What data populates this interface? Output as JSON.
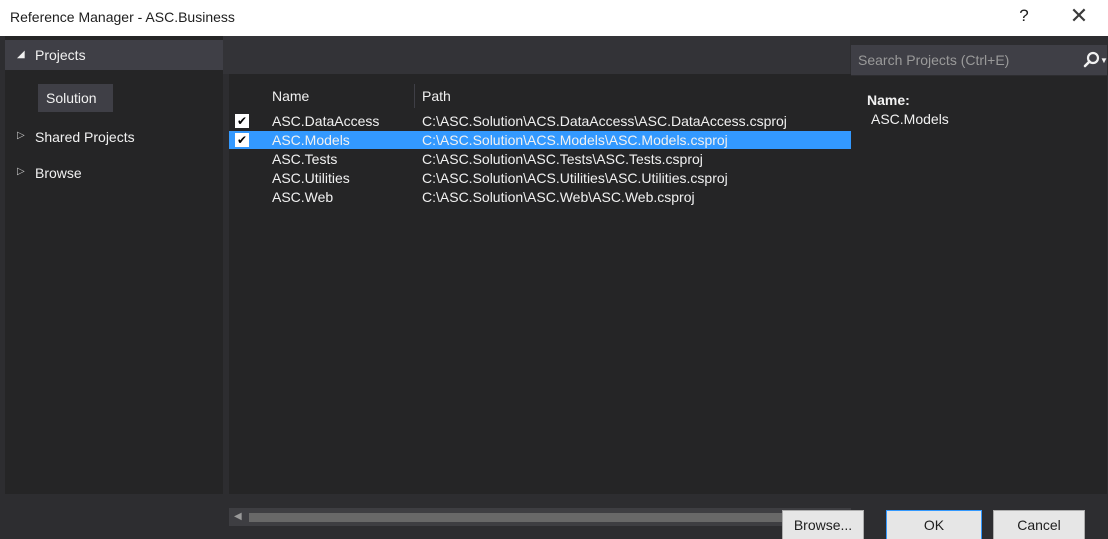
{
  "window": {
    "title": "Reference Manager - ASC.Business",
    "help_glyph": "?",
    "close_glyph": "✕"
  },
  "nav": {
    "header": {
      "label": "Projects",
      "expanded": true
    },
    "selected_sub": "Solution",
    "items": [
      {
        "label": "Shared Projects"
      },
      {
        "label": "Browse"
      }
    ]
  },
  "list": {
    "columns": {
      "name": "Name",
      "path": "Path"
    },
    "rows": [
      {
        "name": "ASC.DataAccess",
        "path": "C:\\ASC.Solution\\ACS.DataAccess\\ASC.DataAccess.csproj",
        "checked": true,
        "selected": false
      },
      {
        "name": "ASC.Models",
        "path": "C:\\ASC.Solution\\ACS.Models\\ASC.Models.csproj",
        "checked": true,
        "selected": true
      },
      {
        "name": "ASC.Tests",
        "path": "C:\\ASC.Solution\\ASC.Tests\\ASC.Tests.csproj",
        "checked": false,
        "selected": false
      },
      {
        "name": "ASC.Utilities",
        "path": "C:\\ASC.Solution\\ACS.Utilities\\ASC.Utilities.csproj",
        "checked": false,
        "selected": false
      },
      {
        "name": "ASC.Web",
        "path": "C:\\ASC.Solution\\ASC.Web\\ASC.Web.csproj",
        "checked": false,
        "selected": false
      }
    ]
  },
  "search": {
    "placeholder": "Search Projects (Ctrl+E)",
    "value": ""
  },
  "details": {
    "label": "Name:",
    "value": "ASC.Models"
  },
  "buttons": {
    "browse": "Browse...",
    "ok": "OK",
    "cancel": "Cancel"
  },
  "colors": {
    "dialog_bg": "#2d2d30",
    "pane_bg": "#252526",
    "selection": "#3399ff",
    "text": "#f1f1f1"
  },
  "icons": {
    "search": "search-icon",
    "dropdown": "chevron-down-icon",
    "expand": "triangle-expanded-icon",
    "collapse": "triangle-collapsed-icon"
  }
}
